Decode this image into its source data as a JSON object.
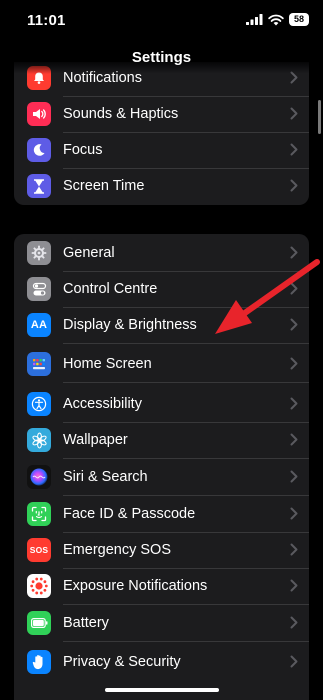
{
  "status_bar": {
    "time": "11:01",
    "battery": "58"
  },
  "nav": {
    "title": "Settings"
  },
  "group1": [
    {
      "label": "Notifications",
      "icon": "bell-icon",
      "color": "#ff3b30"
    },
    {
      "label": "Sounds & Haptics",
      "icon": "speaker-icon",
      "color": "#ff2d55"
    },
    {
      "label": "Focus",
      "icon": "moon-icon",
      "color": "#5e5ce6"
    },
    {
      "label": "Screen Time",
      "icon": "hourglass-icon",
      "color": "#5e5ce6"
    }
  ],
  "group2": [
    {
      "label": "General",
      "icon": "gear-icon",
      "color": "#8e8e93"
    },
    {
      "label": "Control Centre",
      "icon": "toggles-icon",
      "color": "#8e8e93"
    },
    {
      "label": "Display & Brightness",
      "icon": "text-size-icon",
      "icon_text": "AA",
      "color": "#0a84ff"
    },
    {
      "label": "Home Screen",
      "icon": "home-grid-icon",
      "color": "#2c6fdc"
    },
    {
      "label": "Accessibility",
      "icon": "accessibility-icon",
      "color": "#0a84ff"
    },
    {
      "label": "Wallpaper",
      "icon": "flower-icon",
      "color": "#34aadc"
    },
    {
      "label": "Siri & Search",
      "icon": "siri-icon",
      "color": "#111111"
    },
    {
      "label": "Face ID & Passcode",
      "icon": "face-id-icon",
      "color": "#30d158"
    },
    {
      "label": "Emergency SOS",
      "icon": "sos-icon",
      "icon_text": "SOS",
      "color": "#ff3b30"
    },
    {
      "label": "Exposure Notifications",
      "icon": "exposure-icon",
      "color": "#ffffff"
    },
    {
      "label": "Battery",
      "icon": "battery-icon",
      "color": "#30d158"
    },
    {
      "label": "Privacy & Security",
      "icon": "hand-icon",
      "color": "#0a84ff"
    }
  ],
  "colors": {
    "background": "#000000",
    "cell": "#1c1c1e",
    "chevron": "#5a5a5f",
    "arrow": "#e8242b"
  }
}
